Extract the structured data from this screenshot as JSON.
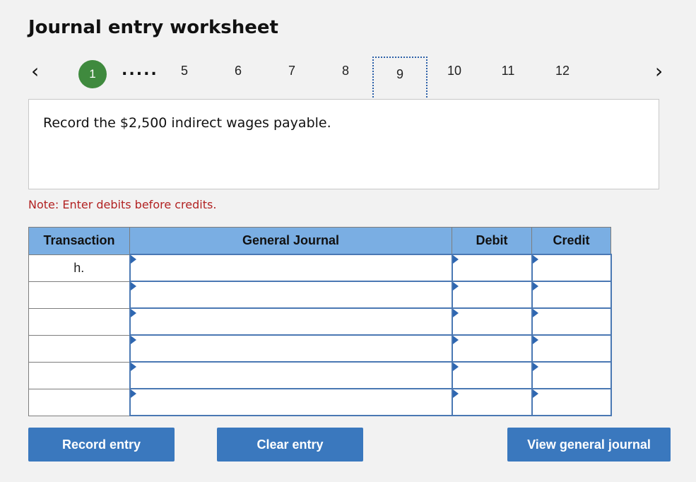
{
  "page": {
    "title": "Journal entry worksheet"
  },
  "pager": {
    "prev_icon": "‹",
    "next_icon": "›",
    "current": "1",
    "ellipsis": ".....",
    "steps": [
      "5",
      "6",
      "7",
      "8",
      "9",
      "10",
      "11",
      "12"
    ],
    "selected": "9",
    "current_color": "#3f8a3e"
  },
  "prompt": {
    "text": "Record the $2,500 indirect wages payable."
  },
  "note": {
    "text": "Note: Enter debits before credits."
  },
  "table": {
    "headers": {
      "transaction": "Transaction",
      "general_journal": "General Journal",
      "debit": "Debit",
      "credit": "Credit"
    },
    "rows": [
      {
        "transaction": "h.",
        "account": "",
        "debit": "",
        "credit": ""
      },
      {
        "transaction": "",
        "account": "",
        "debit": "",
        "credit": ""
      },
      {
        "transaction": "",
        "account": "",
        "debit": "",
        "credit": ""
      },
      {
        "transaction": "",
        "account": "",
        "debit": "",
        "credit": ""
      },
      {
        "transaction": "",
        "account": "",
        "debit": "",
        "credit": ""
      },
      {
        "transaction": "",
        "account": "",
        "debit": "",
        "credit": ""
      }
    ],
    "header_color": "#7aaee3"
  },
  "buttons": {
    "record": "Record entry",
    "clear": "Clear entry",
    "view": "View general journal",
    "color": "#3a78be"
  }
}
